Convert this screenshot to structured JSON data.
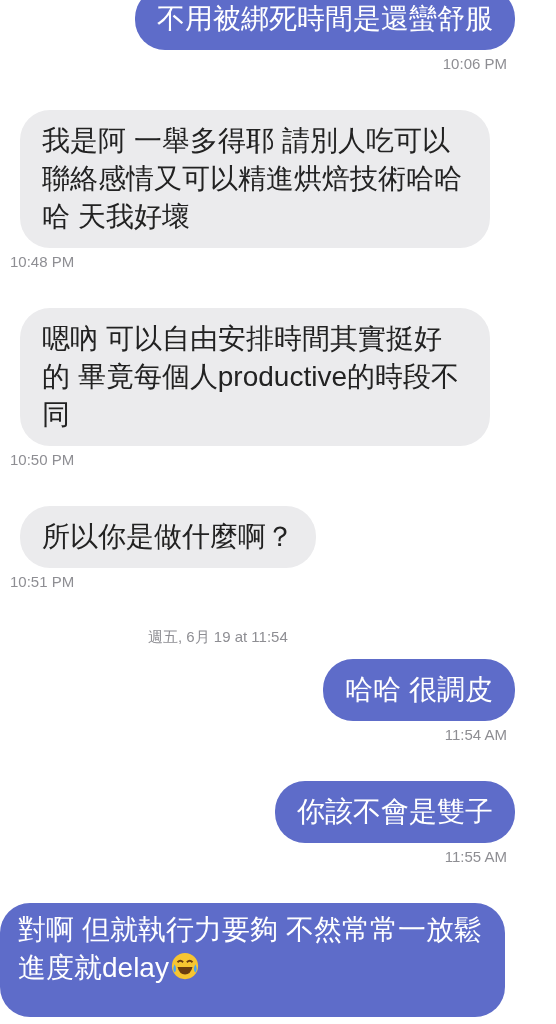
{
  "messages": [
    {
      "kind": "bubble",
      "outgoing": true,
      "text": "不用被綁死時間是還蠻舒服",
      "time": "10:06 PM"
    },
    {
      "kind": "bubble",
      "outgoing": false,
      "text": "我是阿 一舉多得耶 請別人吃可以聯絡感情又可以精進烘焙技術哈哈哈 天我好壞",
      "time": "10:48 PM"
    },
    {
      "kind": "bubble",
      "outgoing": false,
      "text": "嗯吶 可以自由安排時間其實挺好的 畢竟每個人productive的時段不同",
      "time": "10:50 PM"
    },
    {
      "kind": "bubble",
      "outgoing": false,
      "text": "所以你是做什麼啊？",
      "time": "10:51 PM"
    },
    {
      "kind": "date",
      "text": "週五, 6月 19 at 11:54"
    },
    {
      "kind": "bubble",
      "outgoing": true,
      "text": "哈哈 很調皮",
      "time": "11:54 AM"
    },
    {
      "kind": "bubble",
      "outgoing": true,
      "text": "你該不會是雙子",
      "time": "11:55 AM"
    },
    {
      "kind": "bubble",
      "outgoing": true,
      "text": "對啊 但就執行力要夠 不然常常一放鬆進度就delay",
      "emoji": true
    }
  ]
}
